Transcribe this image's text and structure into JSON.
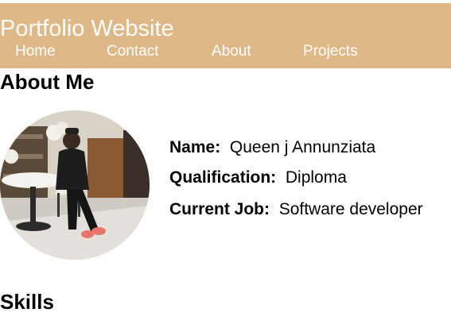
{
  "header": {
    "title": "Portfolio Website",
    "background_color": "#dfb887",
    "text_color": "#ffffff",
    "nav": [
      {
        "label": "Home"
      },
      {
        "label": "Contact"
      },
      {
        "label": "About"
      },
      {
        "label": "Projects"
      }
    ]
  },
  "about": {
    "heading": "About Me",
    "photo_icon": "profile-photo",
    "fields": [
      {
        "label": "Name:",
        "value": "Queen j Annunziata"
      },
      {
        "label": "Qualification:",
        "value": "Diploma"
      },
      {
        "label": "Current Job:",
        "value": "Software developer"
      }
    ]
  },
  "skills": {
    "heading": "Skills"
  }
}
